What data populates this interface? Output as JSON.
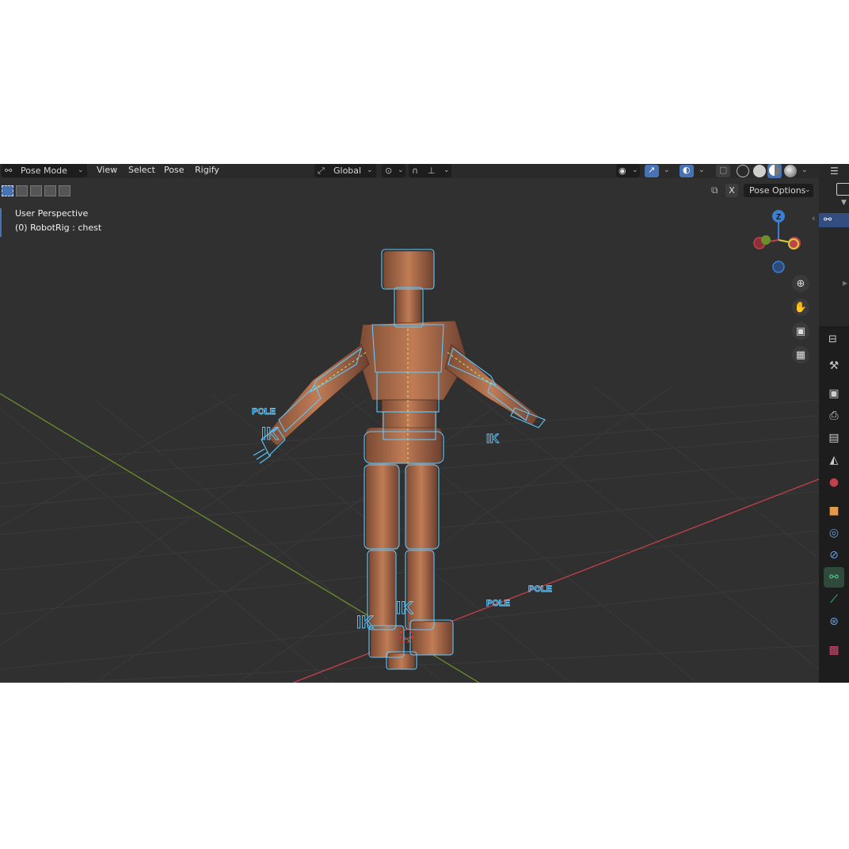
{
  "header": {
    "mode": "Pose Mode",
    "menus": [
      "View",
      "Select",
      "Pose",
      "Rigify"
    ],
    "transform_orientation": "Global"
  },
  "toolbar": {
    "x_label": "X",
    "pose_options": "Pose Options"
  },
  "viewport": {
    "perspective": "User Perspective",
    "active": "(0) RobotRig : chest",
    "gizmo_z": "Z",
    "labels": {
      "pole_left": "POLE",
      "pole_right_1": "POLE",
      "pole_right_2": "POLE",
      "ik_left_arm": "IK",
      "ik_right_arm": "IK",
      "ik_left_leg": "IK",
      "ik_right_leg": "IK"
    }
  },
  "colors": {
    "accent": "#4772b3",
    "bone_wire": "#5ec8ff",
    "axis_x": "#c4414b",
    "axis_y": "#6b8f2a",
    "robot_body": "#b8734e"
  }
}
